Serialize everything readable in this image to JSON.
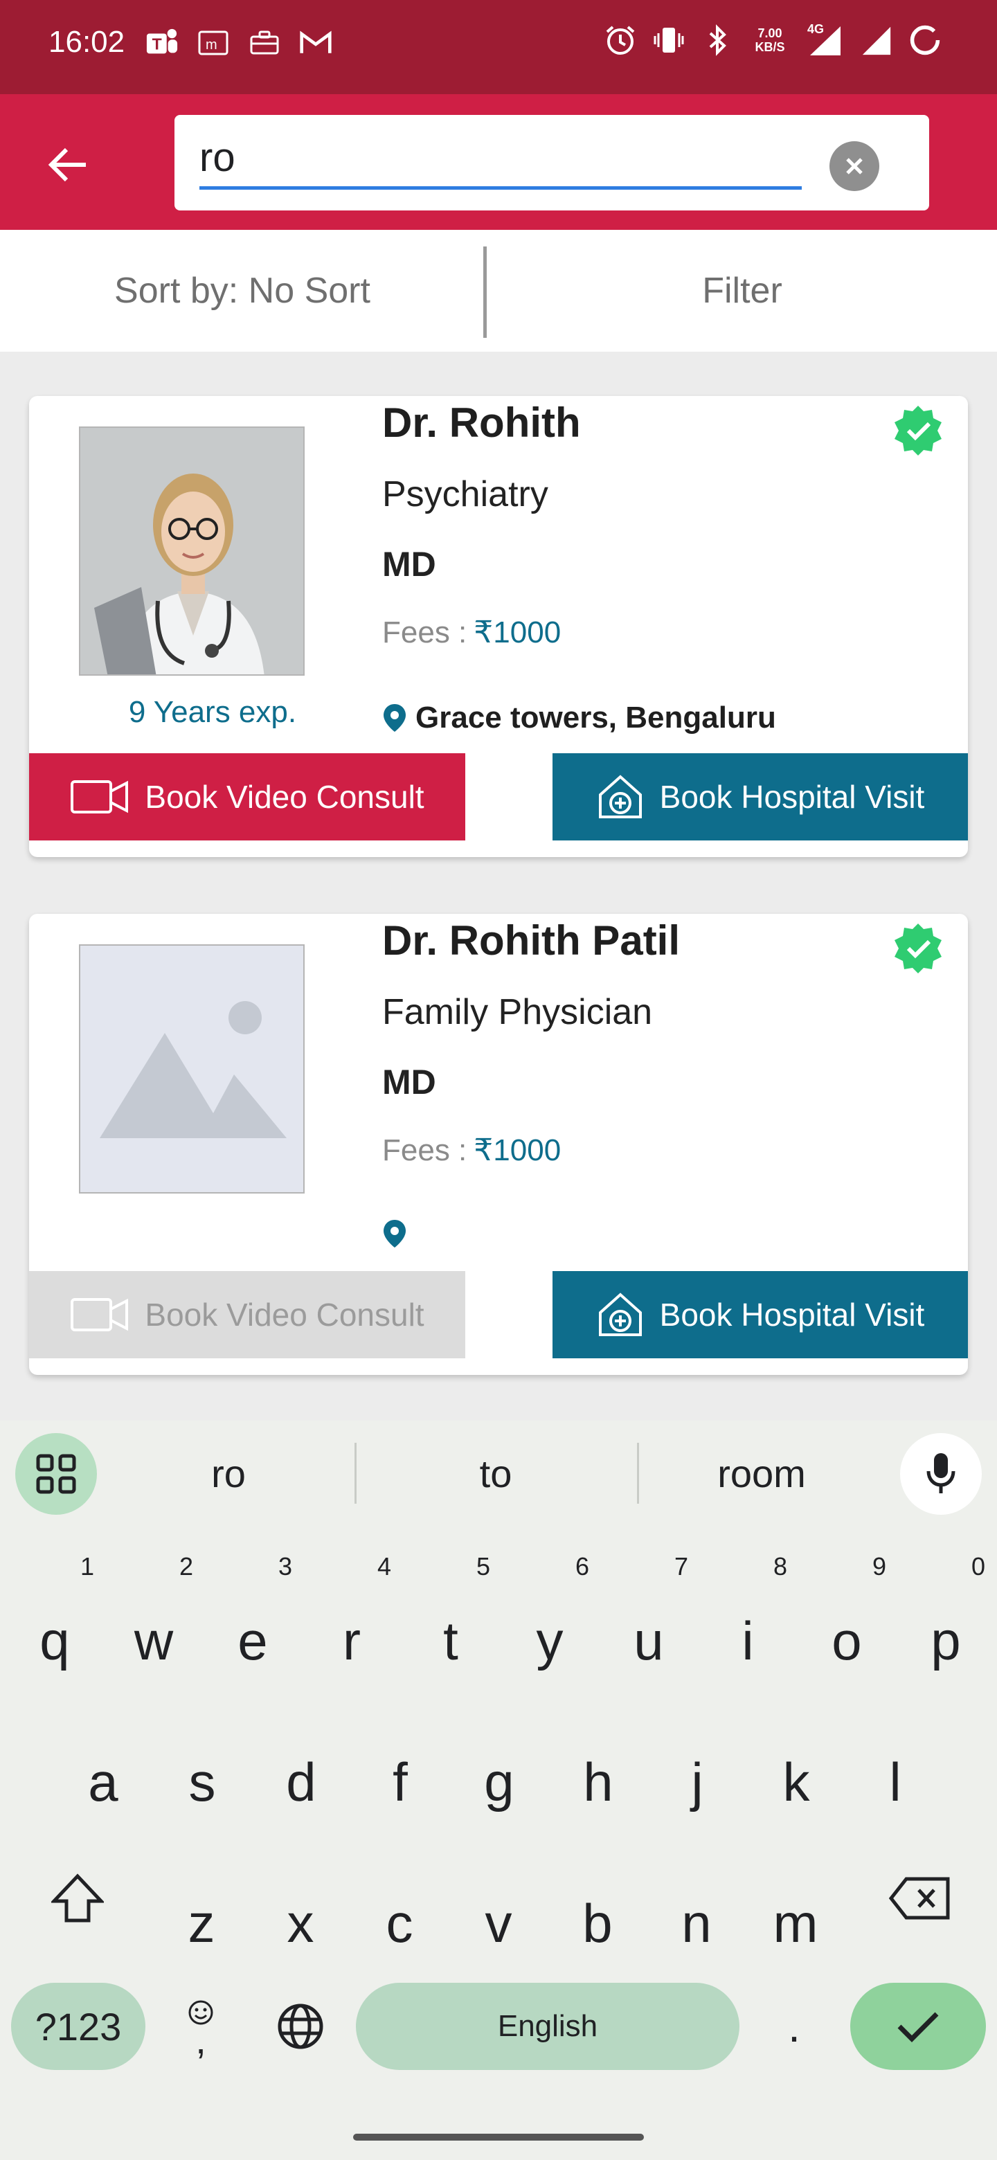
{
  "status_bar": {
    "time": "16:02",
    "net_speed_value": "7.00",
    "net_speed_unit": "KB/S",
    "network_type": "4G",
    "left_icons": [
      "teams-icon",
      "mail-m-icon",
      "briefcase-icon",
      "gmail-icon"
    ],
    "right_icons": [
      "alarm-icon",
      "vibrate-icon",
      "bluetooth-icon",
      "signal-icon",
      "wifi-signal-icon",
      "battery-ring-icon"
    ]
  },
  "app_bar": {
    "search_value": "ro",
    "accent_color": "#cf1f45",
    "status_color": "#9d1c33"
  },
  "sort_bar": {
    "sort_label": "Sort by: No Sort",
    "filter_label": "Filter"
  },
  "doctors": [
    {
      "name": "Dr. Rohith",
      "specialty": "Psychiatry",
      "degree": "MD",
      "fees_label": "Fees :",
      "currency": "₹",
      "fees_amount": "1000",
      "experience": "9 Years exp.",
      "location": "Grace towers, Bengaluru",
      "verified": true,
      "video_label": "Book Video Consult",
      "video_enabled": true,
      "hospital_label": "Book Hospital Visit"
    },
    {
      "name": "Dr. Rohith Patil",
      "specialty": "Family Physician",
      "degree": "MD",
      "fees_label": "Fees :",
      "currency": "₹",
      "fees_amount": "1000",
      "experience": "",
      "location": "",
      "verified": true,
      "video_label": "Book Video Consult",
      "video_enabled": false,
      "hospital_label": "Book Hospital Visit"
    }
  ],
  "keyboard": {
    "suggestions": [
      "ro",
      "to",
      "room"
    ],
    "row1": [
      "q",
      "w",
      "e",
      "r",
      "t",
      "y",
      "u",
      "i",
      "o",
      "p"
    ],
    "row1_hints": [
      "1",
      "2",
      "3",
      "4",
      "5",
      "6",
      "7",
      "8",
      "9",
      "0"
    ],
    "row2": [
      "a",
      "s",
      "d",
      "f",
      "g",
      "h",
      "j",
      "k",
      "l"
    ],
    "row3": [
      "z",
      "x",
      "c",
      "v",
      "b",
      "n",
      "m"
    ],
    "symbols_label": "?123",
    "emoji_comma": ",",
    "space_label": "English",
    "period": "."
  }
}
